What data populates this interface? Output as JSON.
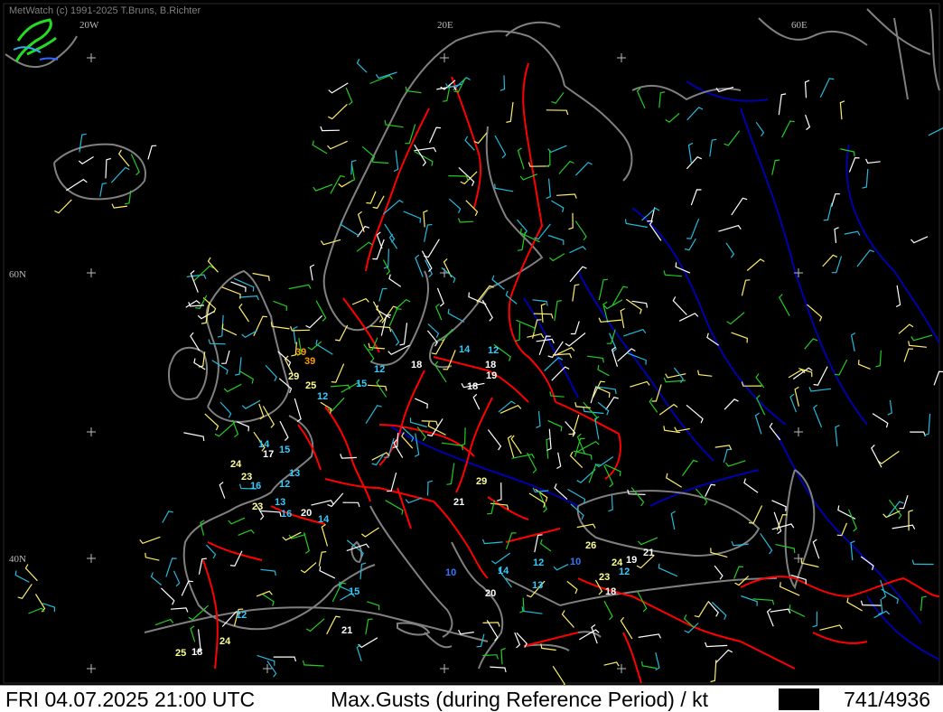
{
  "app": {
    "copyright": "MetWatch  (c) 1991-2025 T.Bruns, B.Richter",
    "logo_name": "metwatch-logo"
  },
  "status_bar": {
    "datetime": "FRI 04.07.2025 21:00 UTC",
    "parameter": "Max.Gusts (during Reference Period) / kt",
    "station_count": "741/4936"
  },
  "grid_labels": {
    "lon": [
      "20W",
      "20E",
      "60E"
    ],
    "lat": [
      "60N",
      "40N"
    ]
  },
  "colors": {
    "background": "#000000",
    "coastline": "#808080",
    "border": "#ff0000",
    "river": "#0000aa",
    "wind_green": "#22cc22",
    "wind_cyan": "#22bbdd",
    "wind_white": "#ffffff",
    "wind_yellow": "#ffee66",
    "gust_cyan": "#33ccff",
    "gust_white": "#ffffff",
    "gust_yellow": "#ffff99",
    "gust_orange": "#ff9900",
    "gust_blue": "#3377ff"
  },
  "gust_labels": [
    {
      "text": "39",
      "color": "orange"
    },
    {
      "text": "39",
      "color": "orange"
    },
    {
      "text": "29",
      "color": "yellow"
    },
    {
      "text": "25",
      "color": "yellow"
    },
    {
      "text": "12",
      "color": "cyan"
    },
    {
      "text": "15",
      "color": "cyan"
    },
    {
      "text": "12",
      "color": "cyan"
    },
    {
      "text": "18",
      "color": "white"
    },
    {
      "text": "14",
      "color": "cyan"
    },
    {
      "text": "12",
      "color": "cyan"
    },
    {
      "text": "18",
      "color": "white"
    },
    {
      "text": "19",
      "color": "white"
    },
    {
      "text": "18",
      "color": "white"
    },
    {
      "text": "14",
      "color": "cyan"
    },
    {
      "text": "17",
      "color": "white"
    },
    {
      "text": "15",
      "color": "cyan"
    },
    {
      "text": "24",
      "color": "yellow"
    },
    {
      "text": "23",
      "color": "yellow"
    },
    {
      "text": "13",
      "color": "cyan"
    },
    {
      "text": "16",
      "color": "cyan"
    },
    {
      "text": "12",
      "color": "cyan"
    },
    {
      "text": "23",
      "color": "yellow"
    },
    {
      "text": "13",
      "color": "cyan"
    },
    {
      "text": "16",
      "color": "cyan"
    },
    {
      "text": "20",
      "color": "white"
    },
    {
      "text": "14",
      "color": "cyan"
    },
    {
      "text": "29",
      "color": "yellow"
    },
    {
      "text": "21",
      "color": "white"
    },
    {
      "text": "26",
      "color": "yellow"
    },
    {
      "text": "21",
      "color": "white"
    },
    {
      "text": "24",
      "color": "yellow"
    },
    {
      "text": "19",
      "color": "white"
    },
    {
      "text": "12",
      "color": "cyan"
    },
    {
      "text": "10",
      "color": "blue"
    },
    {
      "text": "10",
      "color": "blue"
    },
    {
      "text": "14",
      "color": "cyan"
    },
    {
      "text": "23",
      "color": "yellow"
    },
    {
      "text": "12",
      "color": "cyan"
    },
    {
      "text": "13",
      "color": "cyan"
    },
    {
      "text": "18",
      "color": "white"
    },
    {
      "text": "20",
      "color": "white"
    },
    {
      "text": "15",
      "color": "cyan"
    },
    {
      "text": "12",
      "color": "cyan"
    },
    {
      "text": "21",
      "color": "white"
    },
    {
      "text": "25",
      "color": "yellow"
    },
    {
      "text": "18",
      "color": "white"
    },
    {
      "text": "24",
      "color": "yellow"
    }
  ]
}
